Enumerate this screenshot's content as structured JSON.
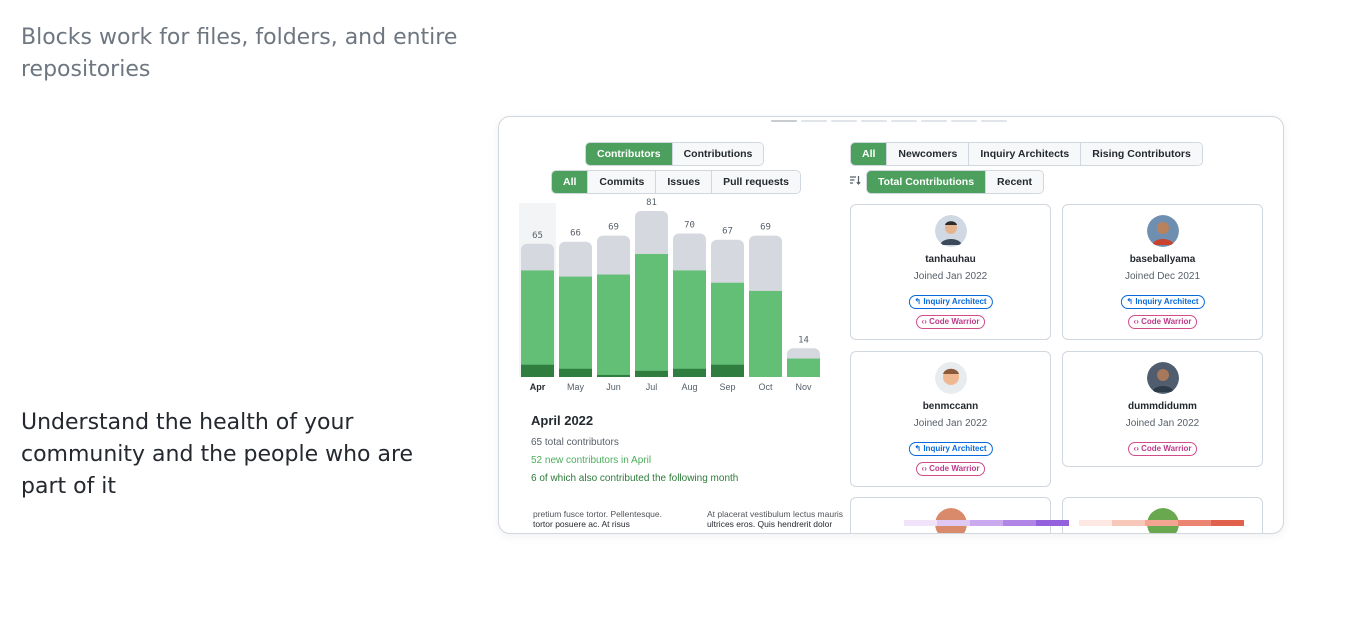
{
  "captions": {
    "top": "Blocks work for files, folders, and entire repositories",
    "mid": "Understand the health of your community and the people who are part of it"
  },
  "left_panel": {
    "view_tabs": [
      {
        "label": "Contributors",
        "active": true
      },
      {
        "label": "Contributions",
        "active": false
      }
    ],
    "type_tabs": [
      {
        "label": "All",
        "active": true
      },
      {
        "label": "Commits",
        "active": false
      },
      {
        "label": "Issues",
        "active": false
      },
      {
        "label": "Pull requests",
        "active": false
      }
    ],
    "summary": {
      "title": "April 2022",
      "total": "65 total contributors",
      "new": "52 new contributors in April",
      "retained": "6 of which also contributed the following month"
    }
  },
  "chart_data": {
    "type": "bar",
    "categories": [
      "Apr",
      "May",
      "Jun",
      "Jul",
      "Aug",
      "Sep",
      "Oct",
      "Nov"
    ],
    "series": [
      {
        "values": [
          65,
          66,
          69,
          81,
          70,
          67,
          69,
          14
        ]
      },
      {
        "values": [
          52,
          49,
          50,
          60,
          52,
          46,
          42,
          9
        ]
      },
      {
        "values": [
          6,
          4,
          1,
          3,
          4,
          6,
          0,
          0
        ]
      }
    ],
    "ylim": [
      0,
      81
    ],
    "highlighted_category": "Apr",
    "colors": {
      "total": "#d5d8de",
      "new": "#63bf75",
      "retained": "#2f7d3f"
    }
  },
  "right_panel": {
    "group_tabs": [
      {
        "label": "All",
        "active": true
      },
      {
        "label": "Newcomers",
        "active": false
      },
      {
        "label": "Inquiry Architects",
        "active": false
      },
      {
        "label": "Rising Contributors",
        "active": false
      }
    ],
    "sort_icon": "sort-descending-icon",
    "sort_tabs": [
      {
        "label": "Total Contributions",
        "active": true
      },
      {
        "label": "Recent",
        "active": false
      }
    ],
    "users": [
      {
        "name": "tanhauhau",
        "joined": "Joined Jan 2022",
        "badges": [
          "Inquiry Architect",
          "Code Warrior"
        ]
      },
      {
        "name": "baseballyama",
        "joined": "Joined Dec 2021",
        "badges": [
          "Inquiry Architect",
          "Code Warrior"
        ]
      },
      {
        "name": "benmccann",
        "joined": "Joined Jan 2022",
        "badges": [
          "Inquiry Architect",
          "Code Warrior"
        ]
      },
      {
        "name": "dummdidumm",
        "joined": "Joined Jan 2022",
        "badges": [
          "Code Warrior"
        ]
      }
    ]
  },
  "background_text": {
    "left_1": "pretium fusce tortor. Pellentesque.",
    "left_2": "tortor posuere ac. At risus",
    "right_1": "At placerat vestibulum lectus mauris",
    "right_2": "ultrices eros. Quis hendrerit dolor"
  },
  "colors": {
    "accent": "#4c9f5c",
    "link": "#0969da",
    "badge_pink": "#bf3989"
  }
}
